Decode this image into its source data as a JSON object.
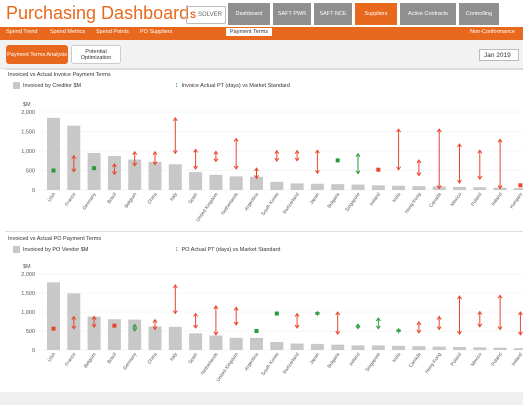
{
  "header": {
    "title": "Purchasing Dashboard",
    "logo_text": "SOLVER",
    "tabs": [
      {
        "label": "Dashboard",
        "active": false
      },
      {
        "label": "SAFT PWR",
        "active": false
      },
      {
        "label": "SAFT NCE",
        "active": false
      },
      {
        "label": "Suppliers",
        "active": true
      },
      {
        "label": "Active Contracts",
        "active": false
      },
      {
        "label": "Controlling",
        "active": false
      }
    ]
  },
  "subnav": {
    "items": [
      "Spend Trend",
      "Spend Metrics",
      "Spend Points",
      "PO Suppliers",
      "Payment Terms"
    ],
    "active": "Payment Terms",
    "right_item": "Non-Conformance"
  },
  "toolbar": {
    "active_button": "Payment Terms Analysis",
    "second_button": "Potential Optimization",
    "date": "Jan 2019"
  },
  "colors": {
    "accent": "#e8691e",
    "bar": "#c8c8c8",
    "green": "#2a9b3c",
    "red": "#e8452a"
  },
  "chart_data": [
    {
      "type": "bar",
      "title": "Invoiced vs Actual Invoice Payment Terms",
      "legend": {
        "bar": "Invoiced by Creditor $M",
        "marker": "Invoice Actual PT (days) vs Market Standard"
      },
      "ylabel": "$M",
      "yticks": [
        "2,000",
        "1,500",
        "1,000",
        "500",
        "0"
      ],
      "ylim": [
        0,
        2000
      ],
      "categories": [
        "USA",
        "France",
        "Germany",
        "Brazil",
        "Belgium",
        "China",
        "Italy",
        "Spain",
        "United Kingdom",
        "Netherlands",
        "Argentina",
        "South Korea",
        "Switzerland",
        "Japan",
        "Bulgaria",
        "Singapore",
        "Ireland",
        "India",
        "Hong Kong",
        "Canada",
        "Mexico",
        "Poland",
        "Ireland",
        "Hungary"
      ],
      "values": [
        1850,
        1650,
        950,
        870,
        780,
        720,
        660,
        460,
        390,
        350,
        340,
        210,
        170,
        160,
        150,
        140,
        120,
        110,
        100,
        90,
        80,
        70,
        60,
        50
      ],
      "markers": [
        {
          "type": "point",
          "color": "green",
          "lo": 500
        },
        {
          "type": "range",
          "color": "red",
          "lo": 470,
          "hi": 880
        },
        {
          "type": "point",
          "color": "green",
          "lo": 560
        },
        {
          "type": "range",
          "color": "red",
          "lo": 400,
          "hi": 670
        },
        {
          "type": "range",
          "color": "red",
          "lo": 620,
          "hi": 980
        },
        {
          "type": "range",
          "color": "red",
          "lo": 650,
          "hi": 980
        },
        {
          "type": "range",
          "color": "red",
          "lo": 940,
          "hi": 1850
        },
        {
          "type": "range",
          "color": "red",
          "lo": 540,
          "hi": 1040
        },
        {
          "type": "range",
          "color": "red",
          "lo": 730,
          "hi": 990
        },
        {
          "type": "range",
          "color": "red",
          "lo": 540,
          "hi": 1320
        },
        {
          "type": "range",
          "color": "red",
          "lo": 300,
          "hi": 560
        },
        {
          "type": "range",
          "color": "red",
          "lo": 740,
          "hi": 1010
        },
        {
          "type": "range",
          "color": "red",
          "lo": 750,
          "hi": 1010
        },
        {
          "type": "range",
          "color": "red",
          "lo": 430,
          "hi": 1020
        },
        {
          "type": "point",
          "color": "green",
          "lo": 760
        },
        {
          "type": "range",
          "color": "green",
          "lo": 420,
          "hi": 930
        },
        {
          "type": "point",
          "color": "red",
          "lo": 520
        },
        {
          "type": "range",
          "color": "red",
          "lo": 520,
          "hi": 1560
        },
        {
          "type": "range",
          "color": "red",
          "lo": 370,
          "hi": 770
        },
        {
          "type": "range",
          "color": "red",
          "lo": 40,
          "hi": 1560
        },
        {
          "type": "range",
          "color": "red",
          "lo": 180,
          "hi": 1180
        },
        {
          "type": "range",
          "color": "red",
          "lo": 280,
          "hi": 1020
        },
        {
          "type": "range",
          "color": "red",
          "lo": 40,
          "hi": 1300
        },
        {
          "type": "point",
          "color": "red",
          "lo": 120
        }
      ]
    },
    {
      "type": "bar",
      "title": "Invoiced vs Actual PO Payment Terms",
      "legend": {
        "bar": "Invoiced by PO Vendor $M",
        "marker": "PO Actual PT (days) vs Market Standard"
      },
      "ylabel": "$M",
      "yticks": [
        "2,000",
        "1,500",
        "1,000",
        "500",
        "0"
      ],
      "ylim": [
        0,
        2000
      ],
      "categories": [
        "USA",
        "France",
        "Belgium",
        "Brazil",
        "Germany",
        "China",
        "Italy",
        "Spain",
        "Netherlands",
        "United Kingdom",
        "Argentina",
        "South Korea",
        "Switzerland",
        "Japan",
        "Bulgaria",
        "Ireland",
        "Singapore",
        "India",
        "Canada",
        "Hong Kong",
        "Poland",
        "Mexico",
        "Poland",
        "Ireland"
      ],
      "values": [
        1780,
        1490,
        880,
        810,
        800,
        620,
        610,
        440,
        380,
        320,
        320,
        210,
        170,
        160,
        140,
        120,
        120,
        110,
        100,
        90,
        80,
        70,
        60,
        50
      ],
      "markers": [
        {
          "type": "point",
          "color": "red",
          "lo": 560
        },
        {
          "type": "range",
          "color": "red",
          "lo": 560,
          "hi": 880
        },
        {
          "type": "range",
          "color": "red",
          "lo": 600,
          "hi": 880
        },
        {
          "type": "point",
          "color": "red",
          "lo": 640
        },
        {
          "type": "range",
          "color": "green",
          "lo": 500,
          "hi": 670
        },
        {
          "type": "range",
          "color": "red",
          "lo": 540,
          "hi": 800
        },
        {
          "type": "range",
          "color": "red",
          "lo": 960,
          "hi": 1710
        },
        {
          "type": "range",
          "color": "red",
          "lo": 580,
          "hi": 960
        },
        {
          "type": "range",
          "color": "red",
          "lo": 400,
          "hi": 1160
        },
        {
          "type": "range",
          "color": "red",
          "lo": 660,
          "hi": 1120
        },
        {
          "type": "point",
          "color": "green",
          "lo": 500
        },
        {
          "type": "point",
          "color": "green",
          "lo": 960
        },
        {
          "type": "range",
          "color": "red",
          "lo": 580,
          "hi": 960
        },
        {
          "type": "range",
          "color": "green",
          "lo": 920,
          "hi": 1010
        },
        {
          "type": "range",
          "color": "red",
          "lo": 420,
          "hi": 1000
        },
        {
          "type": "range",
          "color": "green",
          "lo": 560,
          "hi": 680
        },
        {
          "type": "range",
          "color": "green",
          "lo": 560,
          "hi": 840
        },
        {
          "type": "range",
          "color": "green",
          "lo": 460,
          "hi": 560
        },
        {
          "type": "range",
          "color": "red",
          "lo": 450,
          "hi": 740
        },
        {
          "type": "range",
          "color": "red",
          "lo": 540,
          "hi": 880
        },
        {
          "type": "range",
          "color": "red",
          "lo": 420,
          "hi": 1420
        },
        {
          "type": "range",
          "color": "red",
          "lo": 610,
          "hi": 1010
        },
        {
          "type": "range",
          "color": "red",
          "lo": 540,
          "hi": 1440
        },
        {
          "type": "range",
          "color": "red",
          "lo": 400,
          "hi": 1000
        }
      ]
    }
  ]
}
